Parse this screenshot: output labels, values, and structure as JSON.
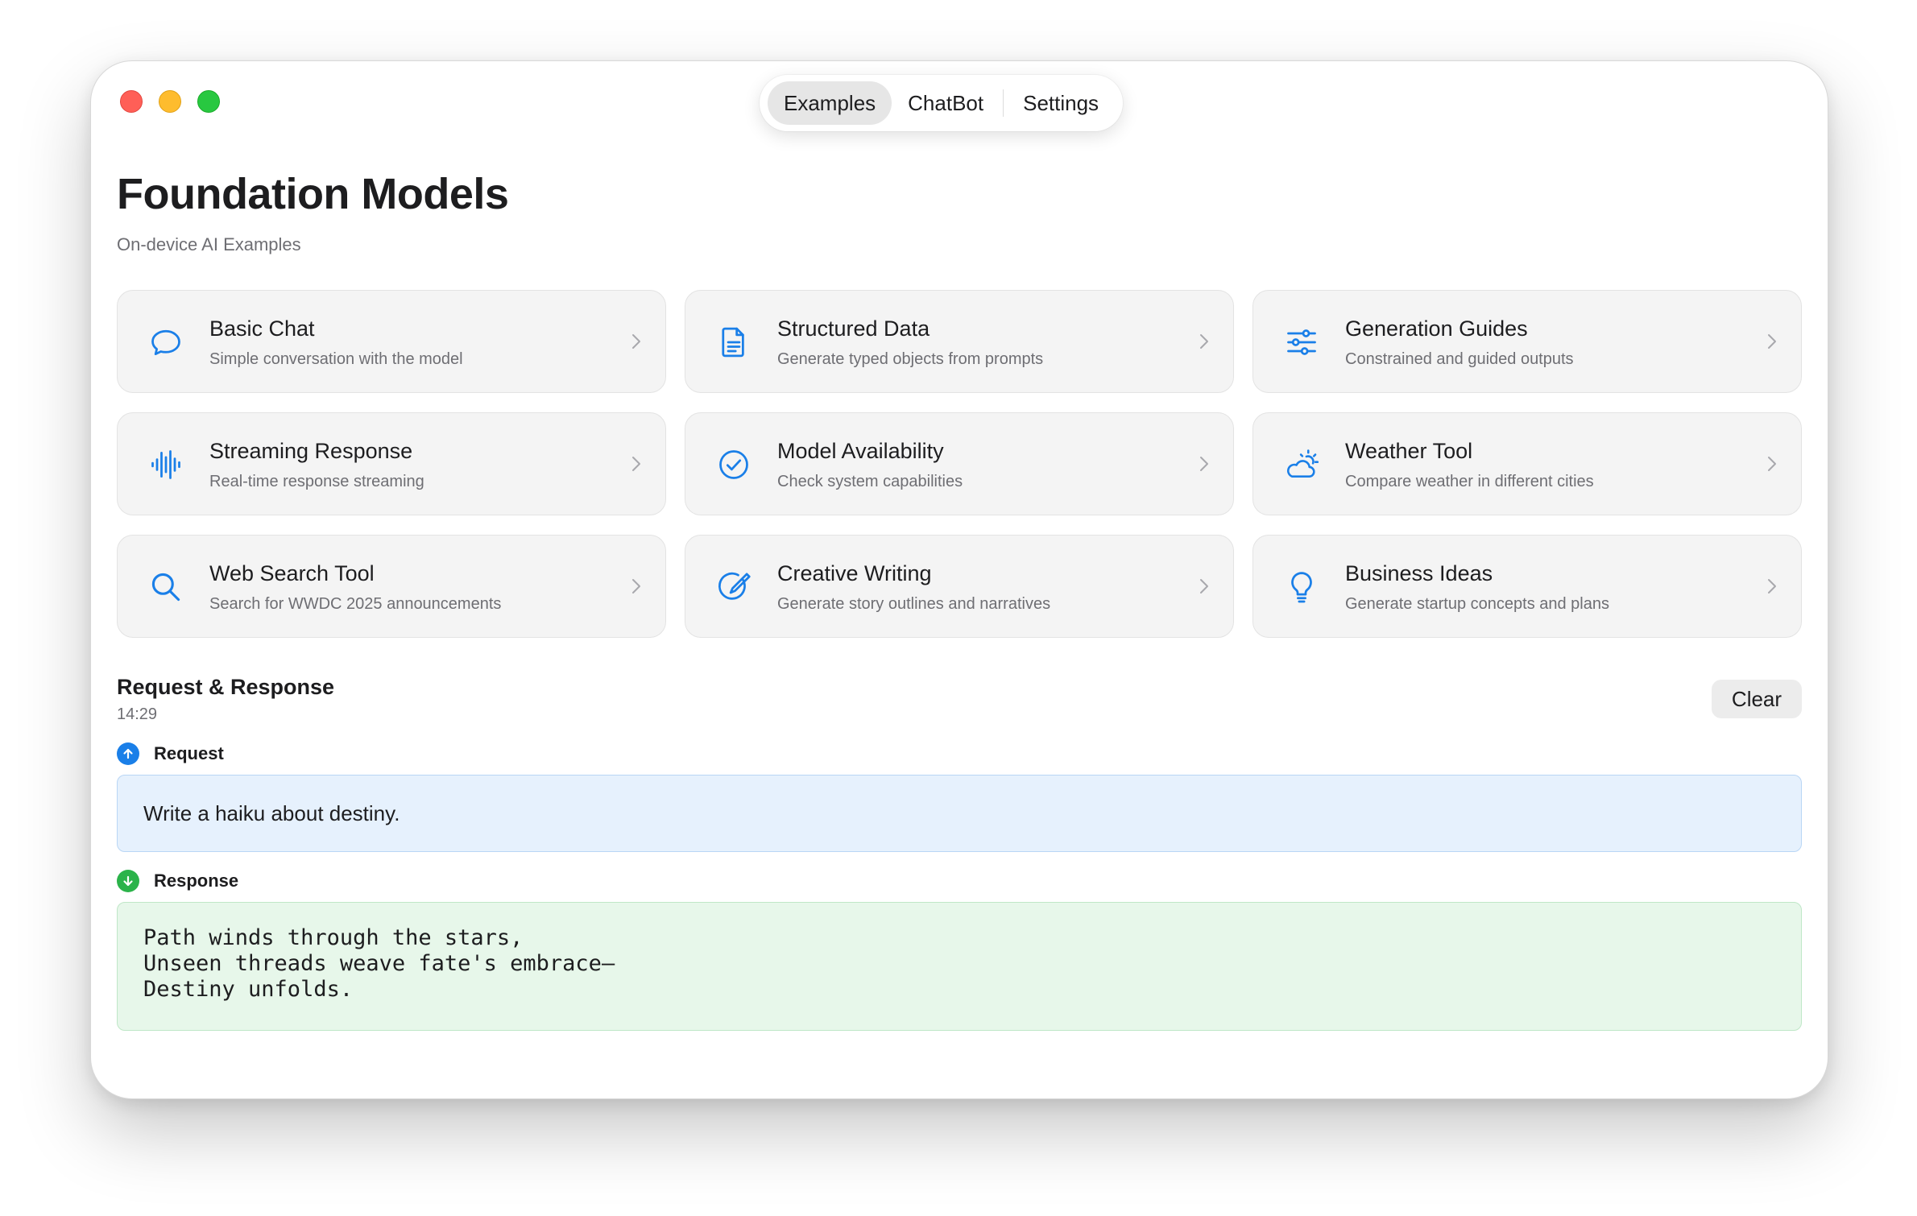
{
  "tabs": [
    {
      "label": "Examples",
      "active": true
    },
    {
      "label": "ChatBot",
      "active": false
    },
    {
      "label": "Settings",
      "active": false
    }
  ],
  "header": {
    "title": "Foundation Models",
    "subtitle": "On-device AI Examples"
  },
  "accent_color": "#1a7fe8",
  "examples": [
    {
      "title": "Basic Chat",
      "description": "Simple conversation with the model",
      "icon": "chat-bubble-icon"
    },
    {
      "title": "Structured Data",
      "description": "Generate typed objects from prompts",
      "icon": "document-icon"
    },
    {
      "title": "Generation Guides",
      "description": "Constrained and guided outputs",
      "icon": "sliders-icon"
    },
    {
      "title": "Streaming Response",
      "description": "Real-time response streaming",
      "icon": "waveform-icon"
    },
    {
      "title": "Model Availability",
      "description": "Check system capabilities",
      "icon": "checkmark-circle-icon"
    },
    {
      "title": "Weather Tool",
      "description": "Compare weather in different cities",
      "icon": "cloud-sun-icon"
    },
    {
      "title": "Web Search Tool",
      "description": "Search for WWDC 2025 announcements",
      "icon": "magnifying-glass-icon"
    },
    {
      "title": "Creative Writing",
      "description": "Generate story outlines and narratives",
      "icon": "pencil-circle-icon"
    },
    {
      "title": "Business Ideas",
      "description": "Generate startup concepts and plans",
      "icon": "lightbulb-icon"
    }
  ],
  "request_response": {
    "title": "Request & Response",
    "time": "14:29",
    "clear_label": "Clear",
    "request_label": "Request",
    "request_text": "Write a haiku about destiny.",
    "response_label": "Response",
    "response_text": "Path winds through the stars,\nUnseen threads weave fate's embrace—\nDestiny unfolds."
  }
}
